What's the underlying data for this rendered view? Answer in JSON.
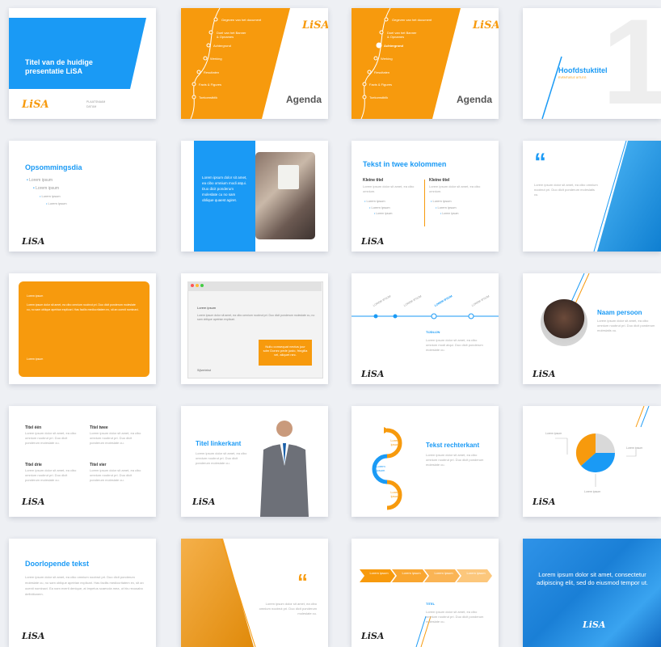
{
  "slides": {
    "s1": {
      "title": "Titel van de huidige presentatie LiSA",
      "place": "PLAATSNAAM",
      "date": "DATUM",
      "logo": "LiSA"
    },
    "s2": {
      "items": [
        "Gegeven van het document",
        "Doel van het Banner & Opnames",
        "Achtergrond",
        "Werking",
        "Resultaten",
        "Facts & Figures",
        "Toekomstblik"
      ],
      "title": "Agenda",
      "logo": "LiSA"
    },
    "s3": {
      "items": [
        "Gegeven van het document",
        "Doel van het Banner & Opnames",
        "Achtergrond",
        "Werking",
        "Resultaten",
        "Facts & Figures",
        "Toekomstblik"
      ],
      "title": "Agenda",
      "logo": "LiSA"
    },
    "s4": {
      "title": "Hoofdstuktitel",
      "subtitle": "EVENTUELE UITLEG",
      "number": "1"
    },
    "s5": {
      "title": "Opsommingsdia",
      "bullets": [
        "Lorem ipsum",
        "Lorem ipsum",
        "Lorem ipsum",
        "Lorem ipsum"
      ],
      "logo": "LiSA"
    },
    "s6": {
      "text": "Lorem ipsum dolor sit amet, ea cibo omnium modi atqui. Duo dicit ponderum moleslate cu no sam oblique quaest agiret."
    },
    "s7": {
      "title": "Tekst in twee kolommen",
      "col1_title": "Kleine titel",
      "col2_title": "Kleine titel",
      "col_text": "Lorem ipsum dolor sit amet, ea cibo omnium.",
      "b1": "Lorem ipsum",
      "b2": "Lorem ipsum",
      "b3": "Lorem ipsum",
      "logo": "LiSA"
    },
    "s8": {
      "quote": "“",
      "text": "Lorem ipsum dolor sit amet, ea cibo omnium noobrut pri. Duo dicit ponderum moleslatis cu."
    },
    "s9": {
      "label": "Lorem ipsum",
      "text": "Lorem ipsum dolor sit amet, ea cibo omnium noobrut pri. Duo dicit ponderum moleslate cu, no sam oblique apeirian explicari. Has facilis mediocritatem ex, sit an ocenit nominavi.",
      "footer": "Lorem ipsum"
    },
    "s10": {
      "heading": "Lorem ipsum",
      "text": "Lorem ipsum dolor sit amet, ea cibo omnium noobrut pri. Duo dicit ponderum moleslate cu, no sam oblique apeirian explicari.",
      "callout": "Nullu consequat nectus juur sdm Donec pede justo, fringilla vel, aliquet nec.",
      "footer": "Sijlvertekst"
    },
    "s11": {
      "labels": [
        "LOREM IPSUM",
        "LOREM IPSUM",
        "LOREM IPSUM",
        "LOREM IPSUM"
      ],
      "section": "TIJDLIJN",
      "text": "Lorem ipsum dolor sit amet, ea cibo omnium modi atqui. Duo dicit ponderum moleslate cu.",
      "logo": "LiSA"
    },
    "s12": {
      "title": "Naam persoon",
      "text": "Lorem ipsum dolor sit amet, ea cibo omnium noobrut pri. Duo dicit ponderum moleslatis cu.",
      "logo": "LiSA"
    },
    "s13": {
      "t1": "Titel één",
      "t2": "Titel twee",
      "t3": "Titel drie",
      "t4": "Titel vier",
      "text": "Lorem ipsum dolor sit amet, ea cibo omnium noobrut pri. Duo dicit ponderum moleslate cu.",
      "logo": "LiSA"
    },
    "s14": {
      "title": "Titel linkerkant",
      "text": "Lorem ipsum dolor sit amet, ea cibo omnium noobrut pri. Duo dicit ponderum moleslate cu.",
      "logo": "LiSA"
    },
    "s15": {
      "cycle": [
        "Lorem ipsum",
        "Lorem ipsum",
        "Lorem ipsum"
      ],
      "title": "Tekst rechterkant",
      "text": "Lorem ipsum dolor sit amet, ea cibo omnium noobrut pri. Duo dicit ponderum moleslate cu."
    },
    "s16": {
      "labels": [
        "Lorem ipsum",
        "Lorem ipsum",
        "Lorem ipsum"
      ],
      "logo": "LiSA"
    },
    "s17": {
      "title": "Doorlopende tekst",
      "text": "Lorem ipsum dolor sit amet, ea cibo omnium noobrut pri. Duo dicit ponderum moleslate cu, no sam oblique apeirian explicari. Has facilis mediocritatem ex, sit an ocenit nominavi. Ea nam everti denique, at impetus scaevola mea, ut his recusabo definitionem.",
      "logo": "LiSA"
    },
    "s18": {
      "quote": "“",
      "text": "Lorem ipsum dolor sit amet, ea cibo omnium noobrut pri. Duo dicit ponderum moleslate cu."
    },
    "s19": {
      "arrows": [
        "Lorem ipsum",
        "Lorem ipsum",
        "Lorem ipsum",
        "Lorem ipsum"
      ],
      "title": "TITEL",
      "text": "Lorem ipsum dolor sit amet, ea cibo omnium noobrut pri. Duo dicit ponderum moleslate cu.",
      "logo": "LiSA"
    },
    "s20": {
      "text": "Lorem ipsum dolor sit amet, consectetur adipiscing elit, sed do eiusmod tempor ut.",
      "logo": "LiSA"
    }
  },
  "colors": {
    "blue": "#1a9af5",
    "orange": "#f79a0d",
    "white": "#ffffff"
  }
}
